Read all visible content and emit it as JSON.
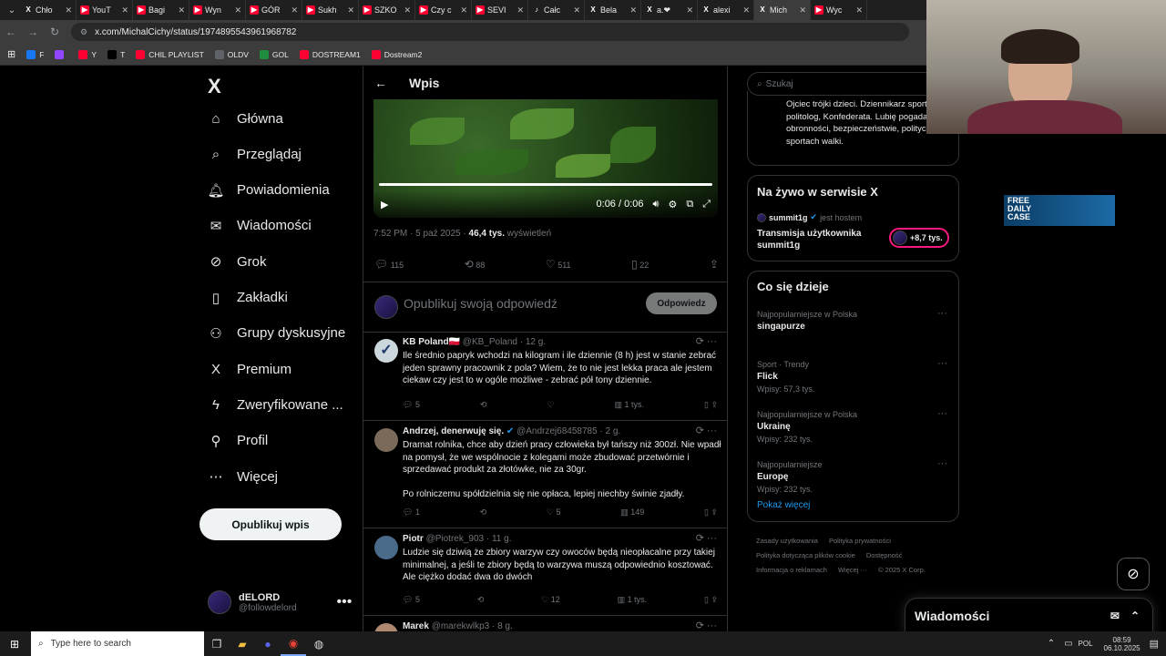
{
  "tabs": [
    {
      "label": "Chło",
      "icon": "x"
    },
    {
      "label": "YouT",
      "icon": "yt"
    },
    {
      "label": "Bagi",
      "icon": "yt"
    },
    {
      "label": "Wyn",
      "icon": "yt"
    },
    {
      "label": "GÓR",
      "icon": "yt"
    },
    {
      "label": "Sukh",
      "icon": "yt"
    },
    {
      "label": "SZKO",
      "icon": "yt"
    },
    {
      "label": "Czy c",
      "icon": "yt"
    },
    {
      "label": "SEVI",
      "icon": "yt"
    },
    {
      "label": "Całc",
      "icon": "tt"
    },
    {
      "label": "Bela",
      "icon": "x"
    },
    {
      "label": "a.❤",
      "icon": "x"
    },
    {
      "label": "alexi",
      "icon": "x"
    },
    {
      "label": "Mich",
      "icon": "x"
    },
    {
      "label": "Wyc",
      "icon": "yt"
    }
  ],
  "browser": {
    "url": "x.com/MichalCichy/status/1974895543961968782"
  },
  "bookmarks": [
    {
      "label": "F",
      "color": "#1877f2"
    },
    {
      "label": "",
      "color": "#9146ff"
    },
    {
      "label": "Y",
      "color": "#ff0033"
    },
    {
      "label": "T",
      "color": "#000"
    },
    {
      "label": "CHIL PLAYLIST",
      "color": "#ff0033"
    },
    {
      "label": "OLDV",
      "color": "#5f6368"
    },
    {
      "label": "GOL",
      "color": "#1e8e3e"
    },
    {
      "label": "DOSTREAM1",
      "color": "#ff0033"
    },
    {
      "label": "Dostream2",
      "color": "#ff0033"
    }
  ],
  "nav": {
    "items": [
      {
        "label": "Główna",
        "icon": "home-icon",
        "glyph": "⌂"
      },
      {
        "label": "Przeglądaj",
        "icon": "search-icon",
        "glyph": "⌕"
      },
      {
        "label": "Powiadomienia",
        "icon": "bell-icon",
        "glyph": "🔔︎"
      },
      {
        "label": "Wiadomości",
        "icon": "mail-icon",
        "glyph": "✉"
      },
      {
        "label": "Grok",
        "icon": "grok-icon",
        "glyph": "⊘"
      },
      {
        "label": "Zakładki",
        "icon": "bookmark-icon",
        "glyph": "▯"
      },
      {
        "label": "Grupy dyskusyjne",
        "icon": "people-icon",
        "glyph": "⚇"
      },
      {
        "label": "Premium",
        "icon": "x-icon",
        "glyph": "X"
      },
      {
        "label": "Zweryfikowane ...",
        "icon": "lightning-icon",
        "glyph": "ϟ"
      },
      {
        "label": "Profil",
        "icon": "person-icon",
        "glyph": "⚲"
      },
      {
        "label": "Więcej",
        "icon": "more-circle-icon",
        "glyph": "⋯"
      }
    ],
    "post_label": "Opublikuj wpis",
    "account_name": "dELORD",
    "account_handle": "@followdelord"
  },
  "post": {
    "header": "Wpis",
    "video_time": "0:06 / 0:06",
    "time": "7:52 PM · 5 paź 2025 · ",
    "views": "46,4 tys.",
    "views_label": " wyświetleń",
    "replies": "115",
    "reposts": "88",
    "likes": "511",
    "bookmarks": "22",
    "reply_placeholder": "Opublikuj swoją odpowiedź",
    "reply_button": "Odpowiedz"
  },
  "tweets": [
    {
      "name": "KB Poland",
      "flag": "🇵🇱",
      "handle": "@KB_Poland · 12 g.",
      "text": "Ile średnio papryk wchodzi na kilogram i ile dziennie (8 h) jest w stanie zebrać jeden sprawny pracownik z pola? Wiem, że to nie jest lekka praca ale jestem ciekaw czy jest to w ogóle możliwe - zebrać pół tony dziennie.",
      "replies": "5",
      "reposts": "",
      "likes": "",
      "views": "1 tys."
    },
    {
      "name": "Andrzej, denerwuję się.",
      "flag": "",
      "handle": "@Andrzej68458785 · 2 g.",
      "text": "Dramat rolnika, chce aby dzień pracy człowieka był tańszy niż 300zł. Nie wpadł na pomysł, że we wspólnocie z kolegami może zbudować przetwórnie i sprzedawać produkt za złotówke, nie za 30gr.",
      "text2": "Po rolniczemu spółdzielnia się nie opłaca, lepiej niechby świnie zjadły.",
      "replies": "1",
      "reposts": "",
      "likes": "5",
      "views": "149"
    },
    {
      "name": "Piotr",
      "flag": "",
      "handle": "@Piotrek_903 · 11 g.",
      "text": "Ludzie się dziwią że zbiory warzyw czy owoców będą nieopłacalne przy takiej minimalnej, a jeśli te zbiory będą to warzywa muszą odpowiednio kosztować. Ale ciężko dodać dwa do dwóch",
      "replies": "5",
      "reposts": "",
      "likes": "12",
      "views": "1 tys."
    },
    {
      "name": "Marek",
      "flag": "",
      "handle": "@marekwlkp3 · 8 g.",
      "text": ""
    }
  ],
  "sidebar": {
    "search_placeholder": "Szukaj",
    "bio": "Ojciec trójki dzieci. Dziennikarz sportowy, politolog, Konfederata. Lubię pogadać o obronności, bezpieczeństwie, polityce i sportach walki.",
    "live": {
      "title": "Na żywo w serwisie X",
      "host": "summit1g",
      "host_role": "jest hostem",
      "stream": "Transmisja użytkownika summit1g",
      "count": "+8,7 tys."
    },
    "trends_title": "Co się dzieje",
    "trends": [
      {
        "context": "Najpopularniejsze w Polska",
        "name": "singapurze",
        "posts": ""
      },
      {
        "context": "Sport · Trendy",
        "name": "Flick",
        "posts": "Wpisy: 57,3 tys."
      },
      {
        "context": "Najpopularniejsze w Polska",
        "name": "Ukrainę",
        "posts": "Wpisy: 232 tys."
      },
      {
        "context": "Najpopularniejsze",
        "name": "Europę",
        "posts": "Wpisy: 232 tys."
      }
    ],
    "show_more": "Pokaż więcej",
    "footer": [
      "Zasady użytkowania",
      "Polityka prywatności",
      "Polityka dotycząca plików cookie",
      "Dostępność",
      "Informacja o reklamach",
      "Więcej ···",
      "© 2025 X Corp."
    ]
  },
  "promo": {
    "line1": "FREE",
    "line2": "DAILY",
    "line3": "CASE"
  },
  "messages_dock": "Wiadomości",
  "taskbar": {
    "search_placeholder": "Type here to search",
    "lang": "POL",
    "time": "08:59",
    "date": "06.10.2025"
  },
  "colors": {
    "accent": "#1d9bf0",
    "live": "#f91880",
    "bg": "#000000"
  }
}
